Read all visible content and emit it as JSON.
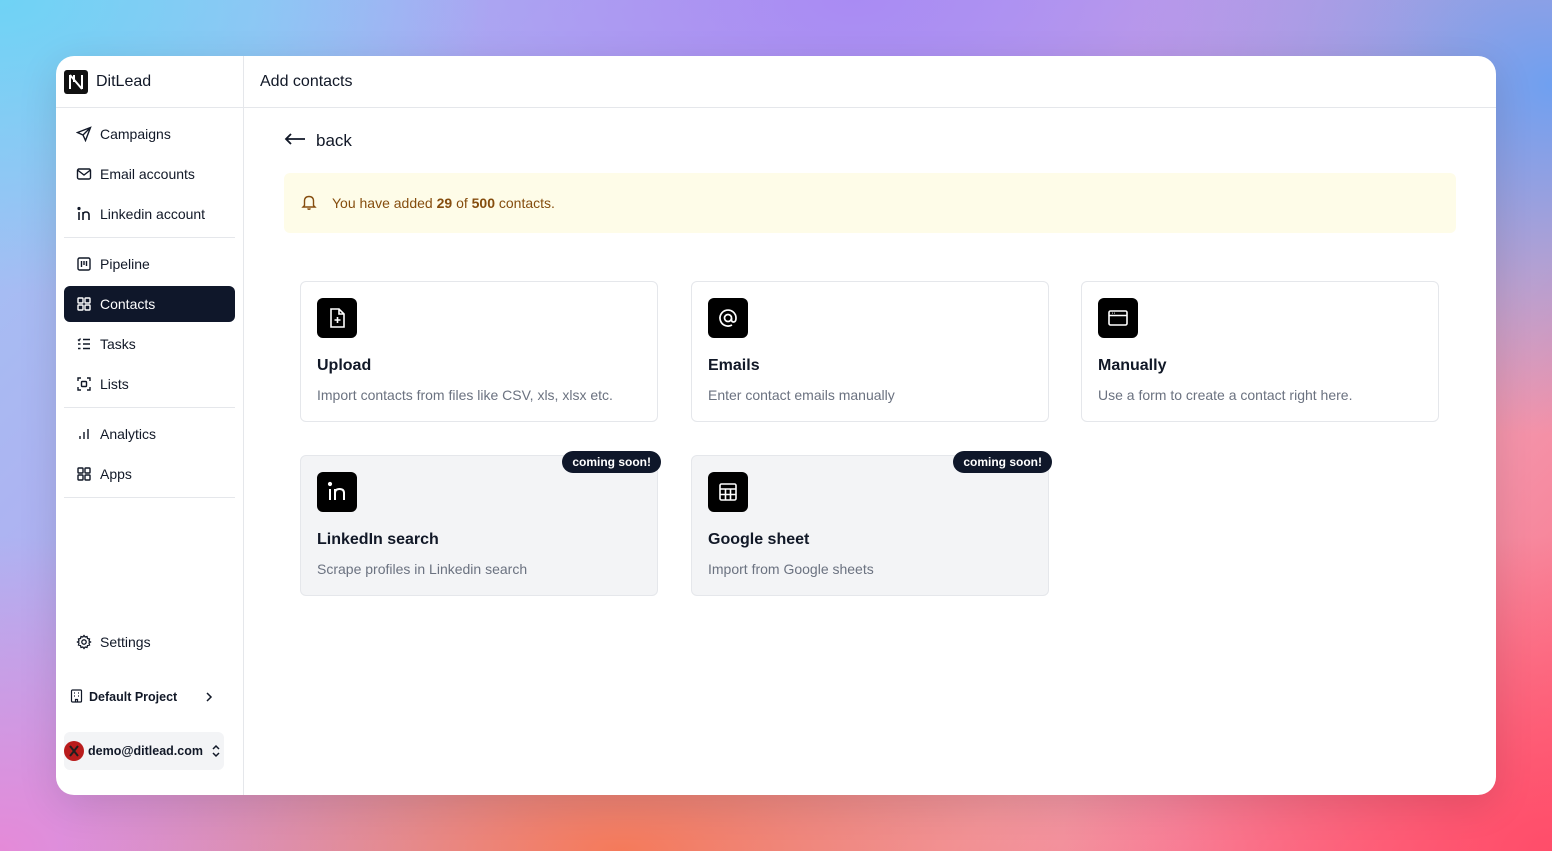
{
  "app": {
    "name": "DitLead"
  },
  "sidebar": {
    "group1": [
      {
        "label": "Campaigns",
        "icon": "send-icon"
      },
      {
        "label": "Email accounts",
        "icon": "mail-icon"
      },
      {
        "label": "Linkedin account",
        "icon": "linkedin-icon"
      }
    ],
    "group2": [
      {
        "label": "Pipeline",
        "icon": "kanban-icon"
      },
      {
        "label": "Contacts",
        "icon": "grid-icon",
        "active": true
      },
      {
        "label": "Tasks",
        "icon": "checklist-icon"
      },
      {
        "label": "Lists",
        "icon": "scan-icon"
      }
    ],
    "group3": [
      {
        "label": "Analytics",
        "icon": "bar-chart-icon"
      },
      {
        "label": "Apps",
        "icon": "apps-grid-icon"
      }
    ],
    "settings": "Settings",
    "project": "Default Project",
    "user_email": "demo@ditlead.com"
  },
  "header": {
    "title": "Add contacts"
  },
  "back_label": "back",
  "notice": {
    "prefix": "You have added",
    "added": "29",
    "middle": "of",
    "limit": "500",
    "suffix": "contacts."
  },
  "cards": [
    {
      "title": "Upload",
      "desc": "Import contacts from files like CSV, xls, xlsx etc.",
      "icon": "file-plus-icon"
    },
    {
      "title": "Emails",
      "desc": "Enter contact emails manually",
      "icon": "at-sign-icon"
    },
    {
      "title": "Manually",
      "desc": "Use a form to create a contact right here.",
      "icon": "browser-window-icon"
    },
    {
      "title": "LinkedIn search",
      "desc": "Scrape profiles in Linkedin search",
      "icon": "linkedin-icon",
      "badge": "coming soon!"
    },
    {
      "title": "Google sheet",
      "desc": "Import from Google sheets",
      "icon": "table-icon",
      "badge": "coming soon!"
    }
  ],
  "colors": {
    "active_bg": "#0f172a",
    "notice_bg": "#fefce8",
    "notice_text": "#854d0e"
  }
}
